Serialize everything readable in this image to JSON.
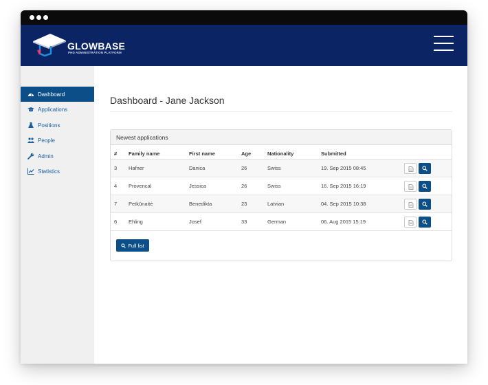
{
  "brand": {
    "name": "GLOWBASE",
    "tagline": "PHD ADMINISTRATION PLATFORM",
    "logo": "graduation-cap-logo",
    "colors": {
      "navbar": "#0b2463",
      "accent": "#0c4f88",
      "link": "#1b5ea0"
    }
  },
  "sidebar": {
    "items": [
      {
        "label": "Dashboard",
        "icon": "dashboard-icon",
        "active": true
      },
      {
        "label": "Applications",
        "icon": "graduation-cap-icon",
        "active": false
      },
      {
        "label": "Positions",
        "icon": "flask-icon",
        "active": false
      },
      {
        "label": "People",
        "icon": "users-icon",
        "active": false
      },
      {
        "label": "Admin",
        "icon": "wrench-icon",
        "active": false
      },
      {
        "label": "Statistics",
        "icon": "line-chart-icon",
        "active": false
      }
    ]
  },
  "main": {
    "title": "Dashboard - Jane Jackson",
    "panel": {
      "heading": "Newest applications",
      "columns": [
        "#",
        "Family name",
        "First name",
        "Age",
        "Nationality",
        "Submitted"
      ],
      "rows": [
        [
          "3",
          "Hafner",
          "Danica",
          "26",
          "Swiss",
          "19. Sep 2015 08:45"
        ],
        [
          "4",
          "Provencal",
          "Jessica",
          "26",
          "Swiss",
          "16. Sep 2015 16:19"
        ],
        [
          "7",
          "Petkūnaitė",
          "Benedikta",
          "23",
          "Latvian",
          "04. Sep 2015 10:38"
        ],
        [
          "6",
          "Ehling",
          "Josef",
          "33",
          "German",
          "06. Aug 2015 15:19"
        ]
      ],
      "row_actions": {
        "document": "document-icon",
        "view": "search-icon"
      },
      "full_list_label": "Full list"
    }
  }
}
